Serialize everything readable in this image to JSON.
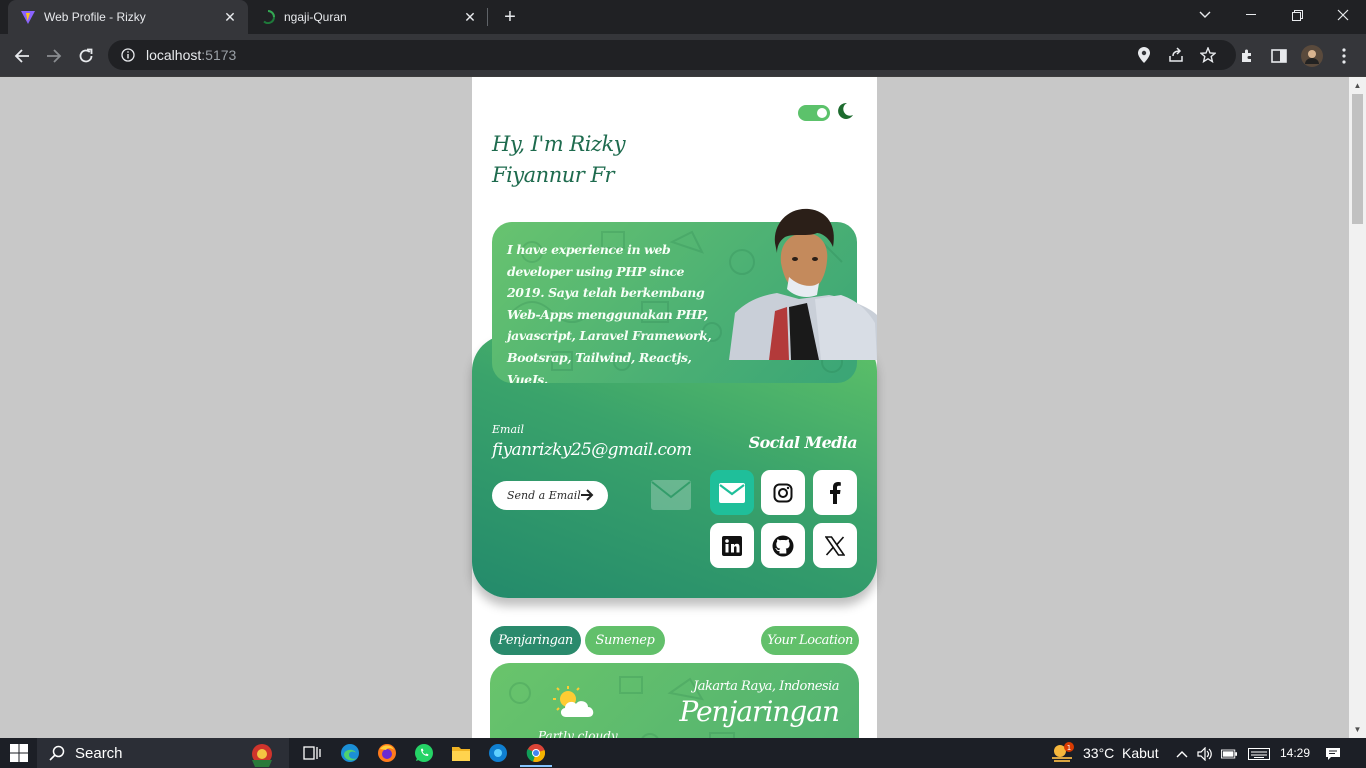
{
  "browser": {
    "tabs": [
      {
        "title": "Web Profile - Rizky",
        "active": true,
        "favicon": "vite-icon"
      },
      {
        "title": "ngaji-Quran",
        "active": false,
        "favicon": "loading-spinner-icon"
      }
    ],
    "url_host": "localhost",
    "url_port": ":5173"
  },
  "page": {
    "greeting": "Hy, I'm Rizky Fiyannur Fr",
    "bio": "I have experience in web developer using PHP since 2019. Saya telah berkembang Web-Apps menggunakan PHP, javascript, Laravel Framework, Bootsrap, Tailwind, Reactjs, VueJs.",
    "email_label": "Email",
    "email_value": "fiyanrizky25@gmail.com",
    "send_email_label": "Send a Email",
    "social_title": "Social Media",
    "socials": [
      "email-icon",
      "instagram-icon",
      "facebook-icon",
      "linkedin-icon",
      "github-icon",
      "x-icon"
    ],
    "city_tabs": [
      {
        "label": "Penjaringan",
        "active": true
      },
      {
        "label": "Sumenep",
        "active": false
      }
    ],
    "your_location_label": "Your Location",
    "weather": {
      "location": "Jakarta Raya, Indonesia",
      "city": "Penjaringan",
      "condition": "Partly cloudy",
      "icon": "partly-cloudy-icon"
    },
    "theme_toggle_on": true
  },
  "colors": {
    "accent_green": "#5cc26b",
    "dark_green": "#1e6b4e",
    "social_active": "#1fbf9a",
    "pill_active": "#2a8a6c",
    "pill_inactive": "#62c06b"
  },
  "taskbar": {
    "search_label": "Search",
    "temperature": "33°C",
    "weather_text": "Kabut",
    "time": "14:29",
    "weather_badge": "1"
  }
}
